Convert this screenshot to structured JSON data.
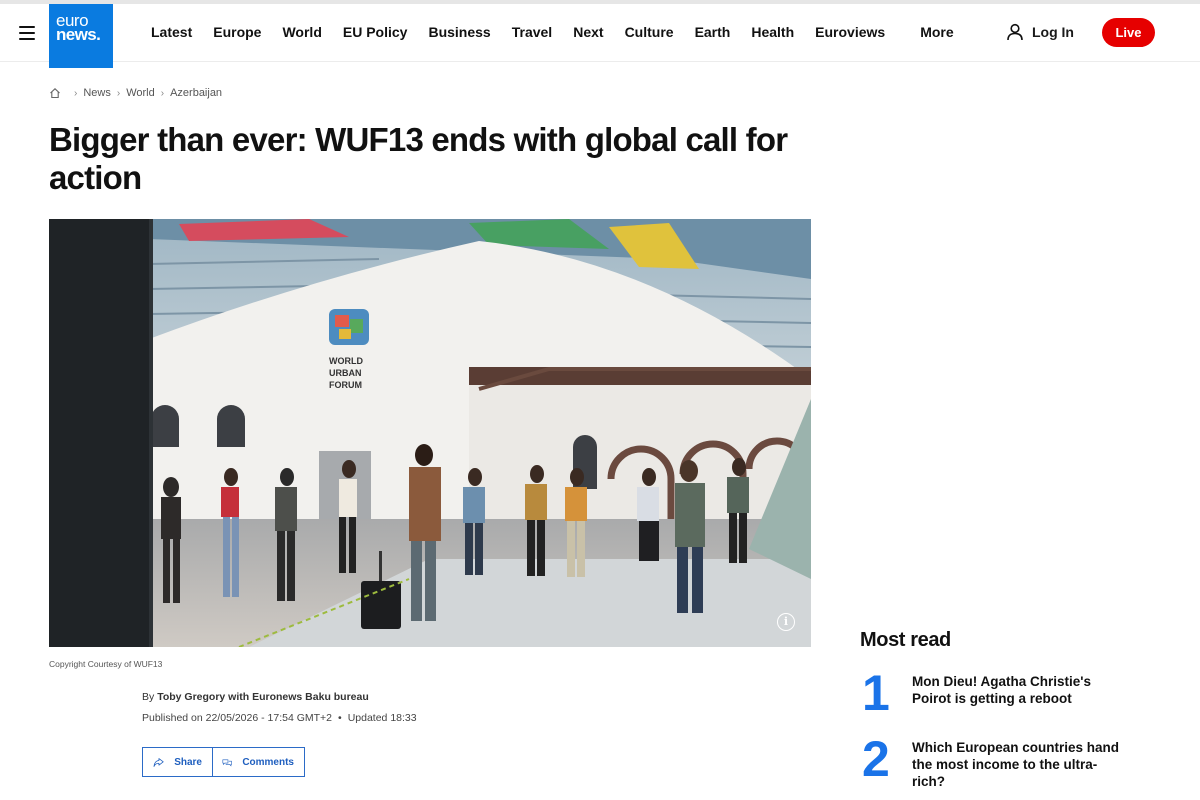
{
  "header": {
    "logo_line1": "euro",
    "logo_line2": "news.",
    "nav": [
      "Latest",
      "Europe",
      "World",
      "EU Policy",
      "Business",
      "Travel",
      "Next",
      "Culture",
      "Earth",
      "Health",
      "Euroviews"
    ],
    "more_label": "More",
    "login_label": "Log In",
    "live_label": "Live"
  },
  "breadcrumb": {
    "items": [
      "News",
      "World",
      "Azerbaijan"
    ]
  },
  "article": {
    "title": "Bigger than ever: WUF13 ends with global call for action",
    "image_sign": [
      "WORLD",
      "URBAN",
      "FORUM"
    ],
    "copyright": "Copyright Courtesy of WUF13",
    "byline_prefix": "By",
    "byline_author": "Toby Gregory with Euronews Baku bureau",
    "published": "Published on 22/05/2026 - 17:54 GMT+2",
    "updated": "Updated 18:33",
    "share_label": "Share",
    "comments_label": "Comments"
  },
  "most_read": {
    "title": "Most read",
    "items": [
      {
        "rank": "1",
        "headline": "Mon Dieu! Agatha Christie's Poirot is getting a reboot"
      },
      {
        "rank": "2",
        "headline": "Which European countries hand the most income to the ultra-rich?"
      }
    ]
  },
  "colors": {
    "brand_blue": "#0a7be0",
    "live_red": "#e60000",
    "rank_blue": "#1a73e8",
    "button_blue": "#1f5fbf"
  }
}
